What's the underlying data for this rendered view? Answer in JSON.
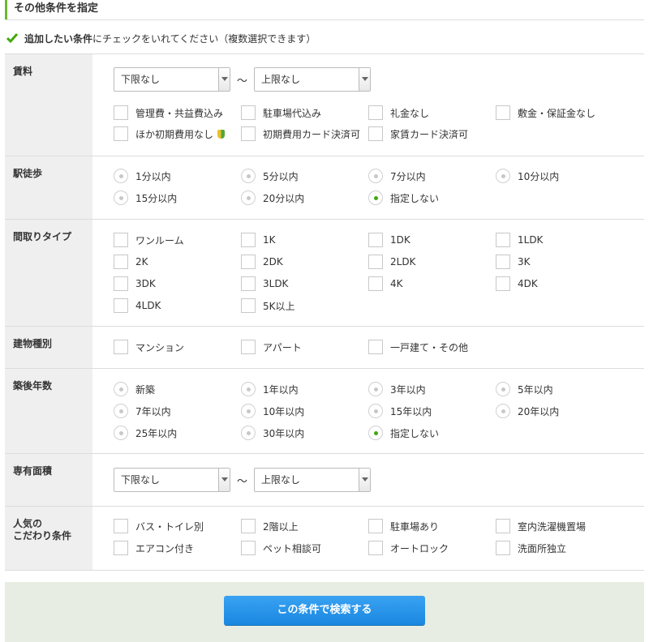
{
  "section": {
    "title": "その他条件を指定"
  },
  "hint": {
    "bold": "追加したい条件",
    "rest": "にチェックをいれてください（複数選択できます）"
  },
  "rent": {
    "label": "賃料",
    "min": "下限なし",
    "max": "上限なし",
    "tilde": "～",
    "options": [
      "管理費・共益費込み",
      "駐車場代込み",
      "礼金なし",
      "敷金・保証金なし",
      "ほか初期費用なし",
      "初期費用カード決済可",
      "家賃カード決済可"
    ]
  },
  "walk": {
    "label": "駅徒歩",
    "options": [
      "1分以内",
      "5分以内",
      "7分以内",
      "10分以内",
      "15分以内",
      "20分以内",
      "指定しない"
    ],
    "selected": "指定しない"
  },
  "layout": {
    "label": "間取りタイプ",
    "options": [
      "ワンルーム",
      "1K",
      "1DK",
      "1LDK",
      "2K",
      "2DK",
      "2LDK",
      "3K",
      "3DK",
      "3LDK",
      "4K",
      "4DK",
      "4LDK",
      "5K以上"
    ]
  },
  "building": {
    "label": "建物種別",
    "options": [
      "マンション",
      "アパート",
      "一戸建て・その他"
    ]
  },
  "age": {
    "label": "築後年数",
    "options": [
      "新築",
      "1年以内",
      "3年以内",
      "5年以内",
      "7年以内",
      "10年以内",
      "15年以内",
      "20年以内",
      "25年以内",
      "30年以内",
      "指定しない"
    ],
    "selected": "指定しない"
  },
  "area": {
    "label": "専有面積",
    "min": "下限なし",
    "max": "上限なし",
    "tilde": "～"
  },
  "popular": {
    "label_line1": "人気の",
    "label_line2": "こだわり条件",
    "options": [
      "バス・トイレ別",
      "2階以上",
      "駐車場あり",
      "室内洗濯機置場",
      "エアコン付き",
      "ペット相談可",
      "オートロック",
      "洗面所独立"
    ]
  },
  "search_button": "この条件で検索する",
  "colors": {
    "accent_green": "#6cb830",
    "radio_selected": "#43a80d",
    "button_blue": "#1a87e0",
    "footer_bg": "#e7ede2",
    "label_bg": "#efefef"
  }
}
